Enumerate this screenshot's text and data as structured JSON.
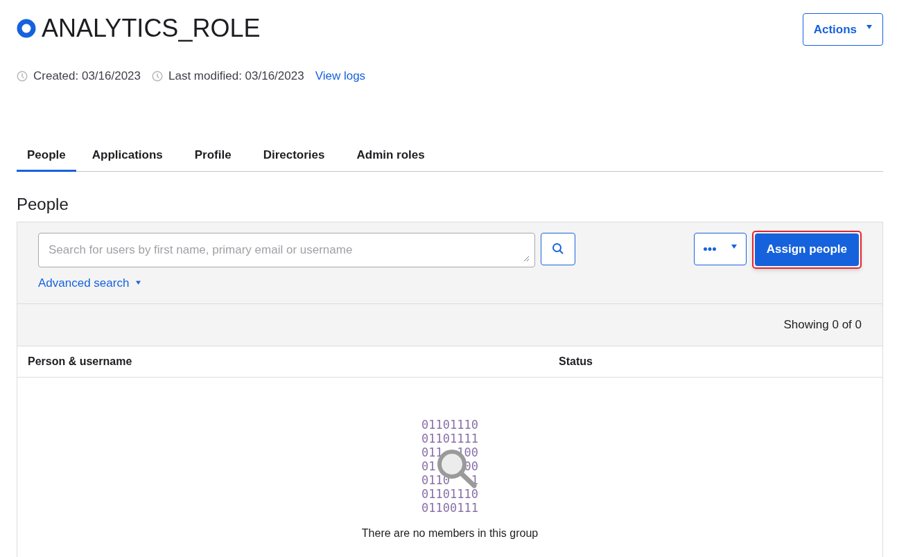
{
  "title": "ANALYTICS_ROLE",
  "actions_button": "Actions",
  "meta": [
    {
      "kind": "clock-text",
      "text": "Created: 03/16/2023"
    },
    {
      "kind": "clock-text",
      "text": "Last modified: 03/16/2023"
    },
    {
      "kind": "link",
      "text": "View logs"
    }
  ],
  "tabs": [
    {
      "label": "People",
      "selected": true
    },
    {
      "label": "Applications",
      "selected": false
    },
    {
      "label": "Profile",
      "selected": false
    },
    {
      "label": "Directories",
      "selected": false
    },
    {
      "label": "Admin roles",
      "selected": false
    }
  ],
  "section_title": "People",
  "search": {
    "placeholder": "Search for users by first name, primary email or username"
  },
  "advanced_search": "Advanced search",
  "assign_button": {
    "label": "Assign people",
    "highlighted": true
  },
  "showing": "Showing 0 of 0",
  "table": {
    "columns": [
      "Person & username",
      "Status"
    ]
  },
  "empty_state": {
    "binary_lines": [
      "01101110",
      "01101111",
      "011  100",
      "01    00",
      "0110   1",
      "01101110",
      "01100111"
    ],
    "message": "There are no members in this group"
  }
}
